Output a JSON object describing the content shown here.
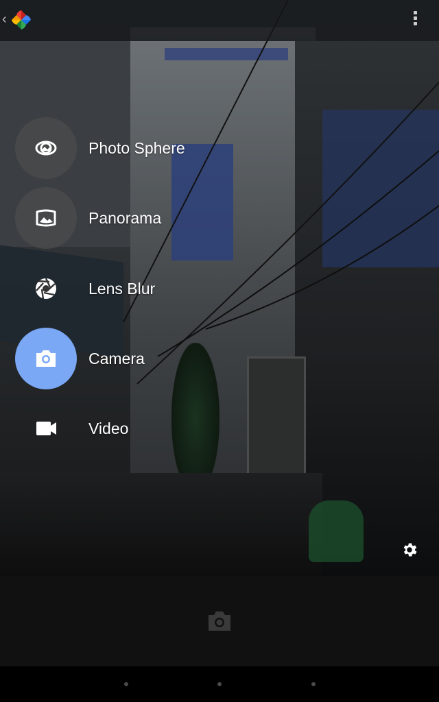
{
  "app": {
    "name": "Camera"
  },
  "icons": {
    "back": "chevron-left-icon",
    "logo": "google-photos-icon",
    "overflow": "more-vert-icon",
    "settings": "gear-icon",
    "shutter": "camera-icon"
  },
  "top_bar": {
    "back_glyph": "‹"
  },
  "modes": [
    {
      "label": "Photo Sphere",
      "icon": "photo-sphere-icon",
      "active": false
    },
    {
      "label": "Panorama",
      "icon": "panorama-icon",
      "active": false
    },
    {
      "label": "Lens Blur",
      "icon": "lens-blur-icon",
      "active": false
    },
    {
      "label": "Camera",
      "icon": "camera-icon",
      "active": true
    },
    {
      "label": "Video",
      "icon": "video-icon",
      "active": false
    }
  ],
  "colors": {
    "active_mode": "#7ba8f5",
    "inactive_mode": "#4a4a4a"
  }
}
